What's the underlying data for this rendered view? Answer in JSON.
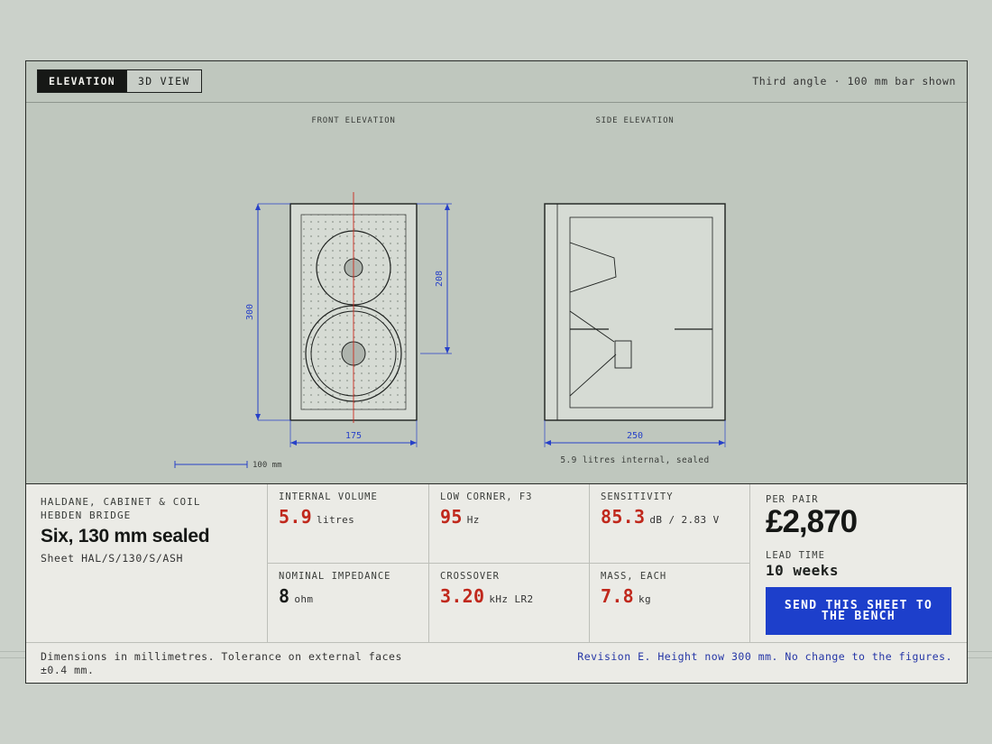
{
  "topbar": {
    "tabs": [
      {
        "label": "ELEVATION",
        "active": true
      },
      {
        "label": "3D VIEW",
        "active": false
      }
    ],
    "note": "Third angle · 100 mm bar shown"
  },
  "drawing": {
    "front_title": "FRONT ELEVATION",
    "side_title": "SIDE ELEVATION",
    "dim_height": "300",
    "dim_driver_span": "208",
    "dim_width": "175",
    "dim_depth": "250",
    "scale_bar_label": "100 mm",
    "side_caption": "5.9 litres internal, sealed",
    "colors": {
      "dimension": "#2741c8",
      "centerline": "#cc2a1e",
      "line": "#1d201e"
    }
  },
  "product": {
    "maker": "HALDANE, CABINET & COIL HEBDEN BRIDGE",
    "model": "Six, 130 mm sealed",
    "sheet": "Sheet HAL/S/130/S/ASH"
  },
  "specs": [
    {
      "label": "INTERNAL VOLUME",
      "value": "5.9",
      "unit": "litres",
      "accent": true
    },
    {
      "label": "LOW CORNER, F3",
      "value": "95",
      "unit": "Hz",
      "accent": true
    },
    {
      "label": "SENSITIVITY",
      "value": "85.3",
      "unit": "dB / 2.83 V",
      "accent": true
    },
    {
      "label": "NOMINAL IMPEDANCE",
      "value": "8",
      "unit": "ohm",
      "accent": false
    },
    {
      "label": "CROSSOVER",
      "value": "3.20",
      "unit": "kHz LR2",
      "accent": true
    },
    {
      "label": "MASS, EACH",
      "value": "7.8",
      "unit": "kg",
      "accent": true
    }
  ],
  "pricing": {
    "label": "PER PAIR",
    "amount": "£2,870",
    "lead_label": "LEAD TIME",
    "lead_value": "10 weeks",
    "cta": "SEND THIS SHEET TO THE BENCH"
  },
  "footer": {
    "left": "Dimensions in millimetres. Tolerance on external faces ±0.4 mm.",
    "right": "Revision E. Height now 300 mm. No change to the figures."
  }
}
